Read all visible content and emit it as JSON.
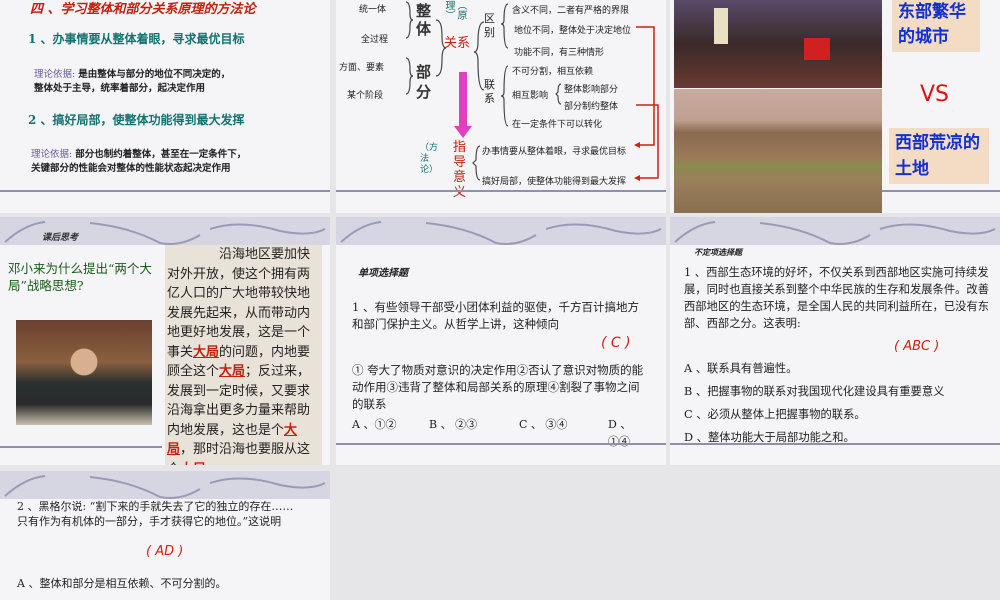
{
  "slide1": {
    "title": "四 、学习整体和部分关系原理的方法论",
    "point1": "1 、办事情要从整体着眼，寻求最优目标",
    "basis_label1": "理论依据:",
    "basis1a": "是由整体与部分的地位不同决定的，",
    "basis1b": "整体处于主导，统率着部分，起决定作用",
    "point2": "2 、搞好局部，使整体功能得到最大发挥",
    "basis_label2": "理论依据:",
    "basis2a": "部分也制约着整体，甚至在一定条件下，",
    "basis2b": "关键部分的性能会对整体的性能状态起决定作用"
  },
  "slide2": {
    "left": [
      "统一体",
      "全过程",
      "方面、要素",
      "某个阶段"
    ],
    "whole": "整体",
    "part": "部分",
    "relation": "关系",
    "principle": "（原理）",
    "method": "（方法论）",
    "guide": "指导意义",
    "diff": "区别",
    "link": "联系",
    "diff_items": [
      "含义不同，二者有严格的界限",
      "地位不同，整体处于决定地位",
      "功能不同，有三种情形"
    ],
    "link_items": [
      "不可分割，相互依赖",
      "相互影响",
      "在一定条件下可以转化"
    ],
    "influence": [
      "整体影响部分",
      "部分制约整体"
    ],
    "guide_items": [
      "办事情要从整体着眼，寻求最优目标",
      "搞好局部，使整体功能得到最大发挥"
    ]
  },
  "slide3": {
    "east": "东部繁华的城市",
    "vs": "VS",
    "west": "西部荒凉的土地"
  },
  "slide4": {
    "header": "课后思考",
    "question": "邓小来为什么提出“两个大局”战略思想?",
    "quote_parts": [
      "沿海地区要加快对外开放，使这个拥有两亿人口的广大地带较快地发展先起来，从而带动内地更好地发展，这是一个事关",
      "大局",
      "的问题，内地要顾全这个",
      "大局",
      "；反过来，发展到一定时候，又要求沿海拿出更多力量来帮助内地发展，这也是个",
      "大局",
      "，那时沿海也要服从这个",
      "大局"
    ]
  },
  "slide5": {
    "header": "单项选择题",
    "question": "1 、有些领导干部受小团体利益的驱使，千方百计搞地方和部门保护主义。从哲学上讲，这种倾向",
    "answer": "( C )",
    "statements": "① 夸大了物质对意识的决定作用②否认了意识对物质的能动作用③违背了整体和局部关系的原理④割裂了事物之间的联系",
    "options": [
      "A 、①②",
      "B 、 ②③",
      "C 、 ③④",
      "D 、①④"
    ]
  },
  "slide6": {
    "header": "不定项选择题",
    "question": "1 、西部生态环境的好坏，不仅关系到西部地区实施可持续发展，同时也直接关系到整个中华民族的生存和发展条件。改善西部地区的生态环境，是全国人民的共同利益所在，已没有东部、西部之分。这表明:",
    "answer": "( ABC )",
    "options": [
      "A 、联系具有普遍性。",
      "B 、把握事物的联系对我国现代化建设具有重要意义",
      "C 、必须从整体上把握事物的联系。",
      "D 、整体功能大于局部功能之和。"
    ]
  },
  "slide7": {
    "question": "2 、黑格尔说: “割下来的手就失去了它的独立的存在……只有作为有机体的一部分，手才获得它的地位。”这说明",
    "answer": "( AD )",
    "options": [
      "A 、整体和部分是相互依赖、不可分割的。"
    ]
  }
}
